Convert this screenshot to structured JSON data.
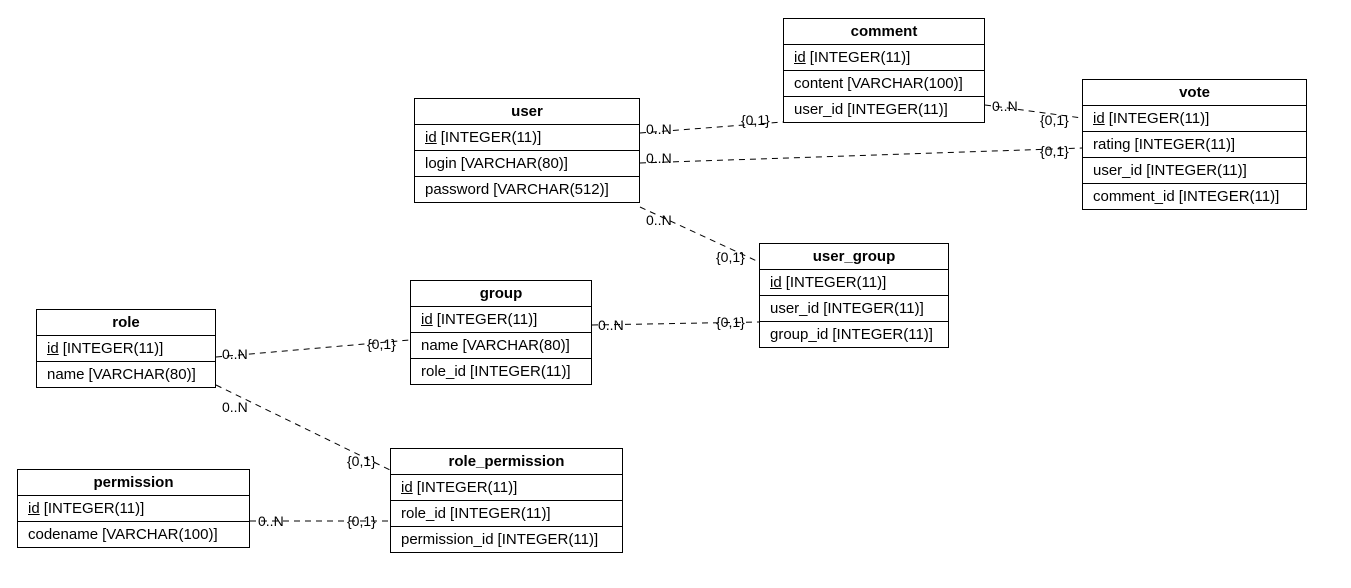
{
  "entities": {
    "role": {
      "title": "role",
      "rows": [
        {
          "name": "id",
          "type": "[INTEGER(11)]",
          "pk": true
        },
        {
          "name": "name",
          "type": "[VARCHAR(80)]",
          "pk": false
        }
      ]
    },
    "permission": {
      "title": "permission",
      "rows": [
        {
          "name": "id",
          "type": "[INTEGER(11)]",
          "pk": true
        },
        {
          "name": "codename",
          "type": "[VARCHAR(100)]",
          "pk": false
        }
      ]
    },
    "user": {
      "title": "user",
      "rows": [
        {
          "name": "id",
          "type": "[INTEGER(11)]",
          "pk": true
        },
        {
          "name": "login",
          "type": "[VARCHAR(80)]",
          "pk": false
        },
        {
          "name": "password",
          "type": "[VARCHAR(512)]",
          "pk": false
        }
      ]
    },
    "group": {
      "title": "group",
      "rows": [
        {
          "name": "id",
          "type": "[INTEGER(11)]",
          "pk": true
        },
        {
          "name": "name",
          "type": "[VARCHAR(80)]",
          "pk": false
        },
        {
          "name": "role_id",
          "type": "[INTEGER(11)]",
          "pk": false
        }
      ]
    },
    "role_permission": {
      "title": "role_permission",
      "rows": [
        {
          "name": "id",
          "type": "[INTEGER(11)]",
          "pk": true
        },
        {
          "name": "role_id",
          "type": "[INTEGER(11)]",
          "pk": false
        },
        {
          "name": "permission_id",
          "type": "[INTEGER(11)]",
          "pk": false
        }
      ]
    },
    "comment": {
      "title": "comment",
      "rows": [
        {
          "name": "id",
          "type": "[INTEGER(11)]",
          "pk": true
        },
        {
          "name": "content",
          "type": "[VARCHAR(100)]",
          "pk": false
        },
        {
          "name": "user_id",
          "type": "[INTEGER(11)]",
          "pk": false
        }
      ]
    },
    "user_group": {
      "title": "user_group",
      "rows": [
        {
          "name": "id",
          "type": "[INTEGER(11)]",
          "pk": true
        },
        {
          "name": "user_id",
          "type": "[INTEGER(11)]",
          "pk": false
        },
        {
          "name": "group_id",
          "type": "[INTEGER(11)]",
          "pk": false
        }
      ]
    },
    "vote": {
      "title": "vote",
      "rows": [
        {
          "name": "id",
          "type": "[INTEGER(11)]",
          "pk": true
        },
        {
          "name": "rating",
          "type": "[INTEGER(11)]",
          "pk": false
        },
        {
          "name": "user_id",
          "type": "[INTEGER(11)]",
          "pk": false
        },
        {
          "name": "comment_id",
          "type": "[INTEGER(11)]",
          "pk": false
        }
      ]
    }
  },
  "cards": {
    "user_comment_a": "0..N",
    "user_comment_b": "{0,1}",
    "user_vote_a": "0..N",
    "user_vote_b": "{0,1}",
    "comment_vote_a": "0..N",
    "comment_vote_b": "{0,1}",
    "user_ug_a": "0..N",
    "user_ug_b": "{0,1}",
    "group_ug_a": "0..N",
    "group_ug_b": "{0,1}",
    "role_group_a": "0..N",
    "role_group_b": "{0,1}",
    "role_rp_a": "0..N",
    "role_rp_b": "{0,1}",
    "perm_rp_a": "0..N",
    "perm_rp_b": "{0,1}"
  },
  "chart_data": {
    "type": "er-diagram",
    "entities": [
      {
        "name": "role",
        "columns": [
          "id INTEGER(11) PK",
          "name VARCHAR(80)"
        ]
      },
      {
        "name": "permission",
        "columns": [
          "id INTEGER(11) PK",
          "codename VARCHAR(100)"
        ]
      },
      {
        "name": "user",
        "columns": [
          "id INTEGER(11) PK",
          "login VARCHAR(80)",
          "password VARCHAR(512)"
        ]
      },
      {
        "name": "group",
        "columns": [
          "id INTEGER(11) PK",
          "name VARCHAR(80)",
          "role_id INTEGER(11)"
        ]
      },
      {
        "name": "role_permission",
        "columns": [
          "id INTEGER(11) PK",
          "role_id INTEGER(11)",
          "permission_id INTEGER(11)"
        ]
      },
      {
        "name": "comment",
        "columns": [
          "id INTEGER(11) PK",
          "content VARCHAR(100)",
          "user_id INTEGER(11)"
        ]
      },
      {
        "name": "user_group",
        "columns": [
          "id INTEGER(11) PK",
          "user_id INTEGER(11)",
          "group_id INTEGER(11)"
        ]
      },
      {
        "name": "vote",
        "columns": [
          "id INTEGER(11) PK",
          "rating INTEGER(11)",
          "user_id INTEGER(11)",
          "comment_id INTEGER(11)"
        ]
      }
    ],
    "relationships": [
      {
        "from": "user",
        "to": "comment",
        "from_card": "0..N",
        "to_card": "{0,1}"
      },
      {
        "from": "user",
        "to": "vote",
        "from_card": "0..N",
        "to_card": "{0,1}"
      },
      {
        "from": "comment",
        "to": "vote",
        "from_card": "0..N",
        "to_card": "{0,1}"
      },
      {
        "from": "user",
        "to": "user_group",
        "from_card": "0..N",
        "to_card": "{0,1}"
      },
      {
        "from": "group",
        "to": "user_group",
        "from_card": "0..N",
        "to_card": "{0,1}"
      },
      {
        "from": "role",
        "to": "group",
        "from_card": "0..N",
        "to_card": "{0,1}"
      },
      {
        "from": "role",
        "to": "role_permission",
        "from_card": "0..N",
        "to_card": "{0,1}"
      },
      {
        "from": "permission",
        "to": "role_permission",
        "from_card": "0..N",
        "to_card": "{0,1}"
      }
    ]
  }
}
